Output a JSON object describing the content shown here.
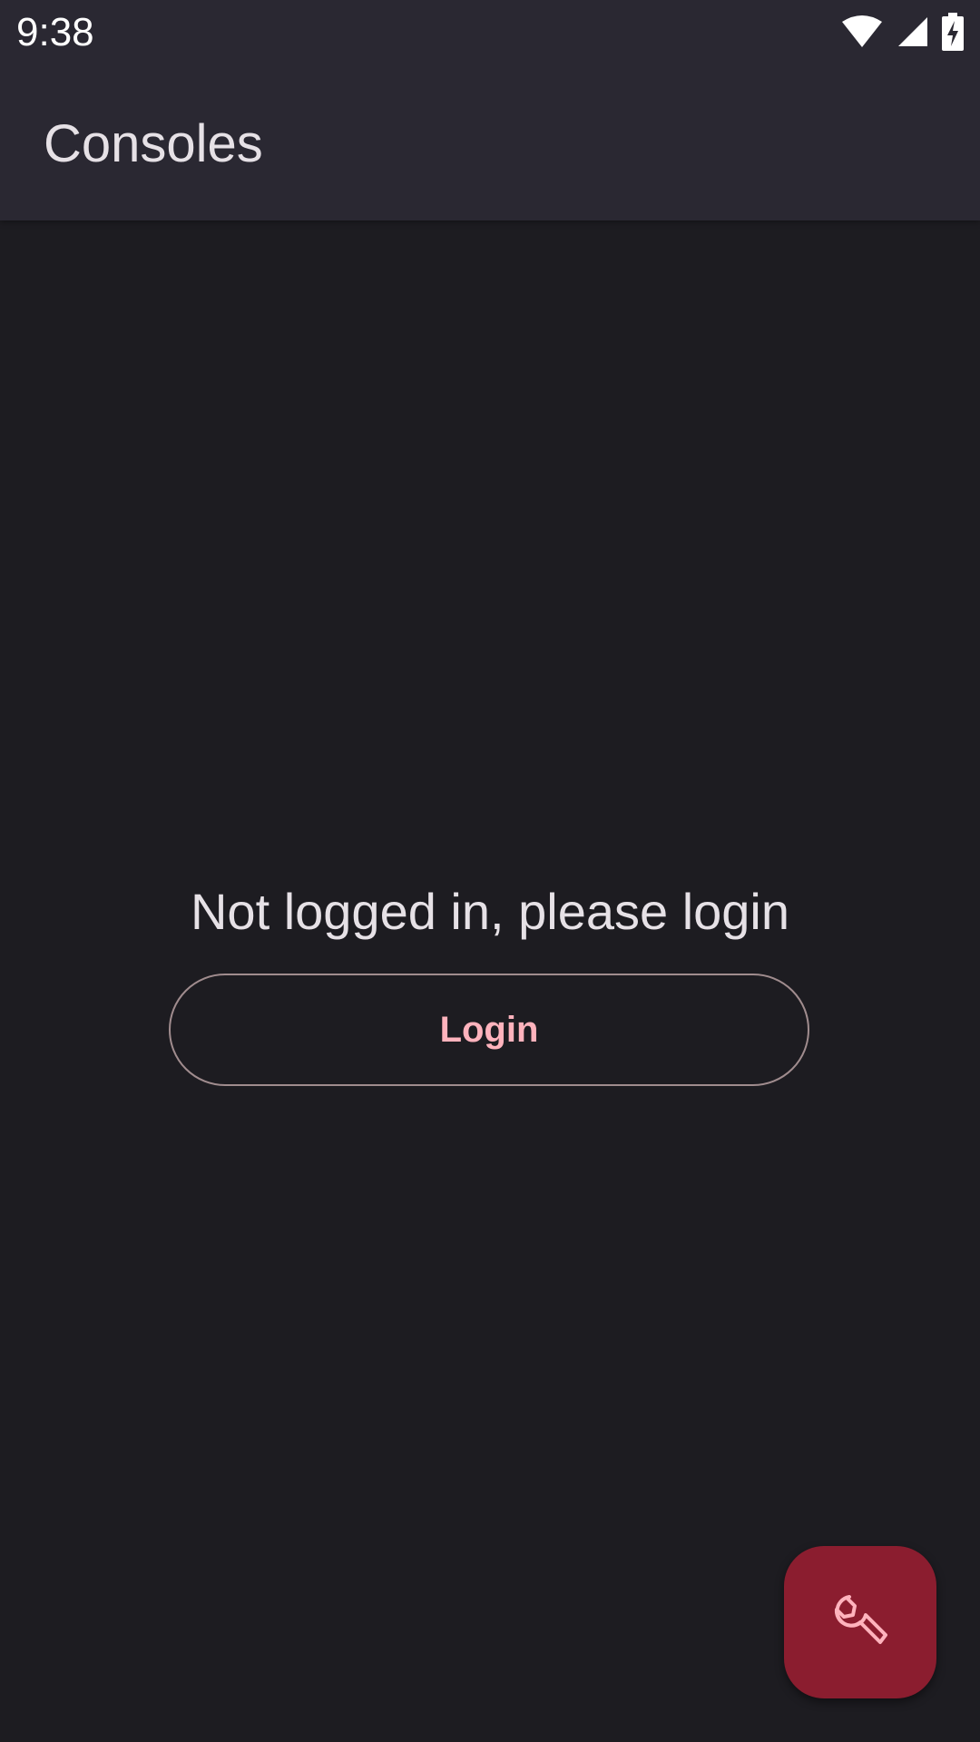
{
  "status_bar": {
    "time": "9:38",
    "icons": [
      "wifi-icon",
      "signal-icon",
      "battery-charging-icon"
    ]
  },
  "app_bar": {
    "title": "Consoles"
  },
  "main": {
    "message": "Not logged in, please login",
    "login_button_label": "Login"
  },
  "fab": {
    "icon": "wrench-icon"
  },
  "colors": {
    "background": "#1d1c21",
    "app_bar": "#2a2832",
    "primary_text": "#e6e1e6",
    "accent": "#ffb3bd",
    "fab": "#8b1d2f"
  }
}
